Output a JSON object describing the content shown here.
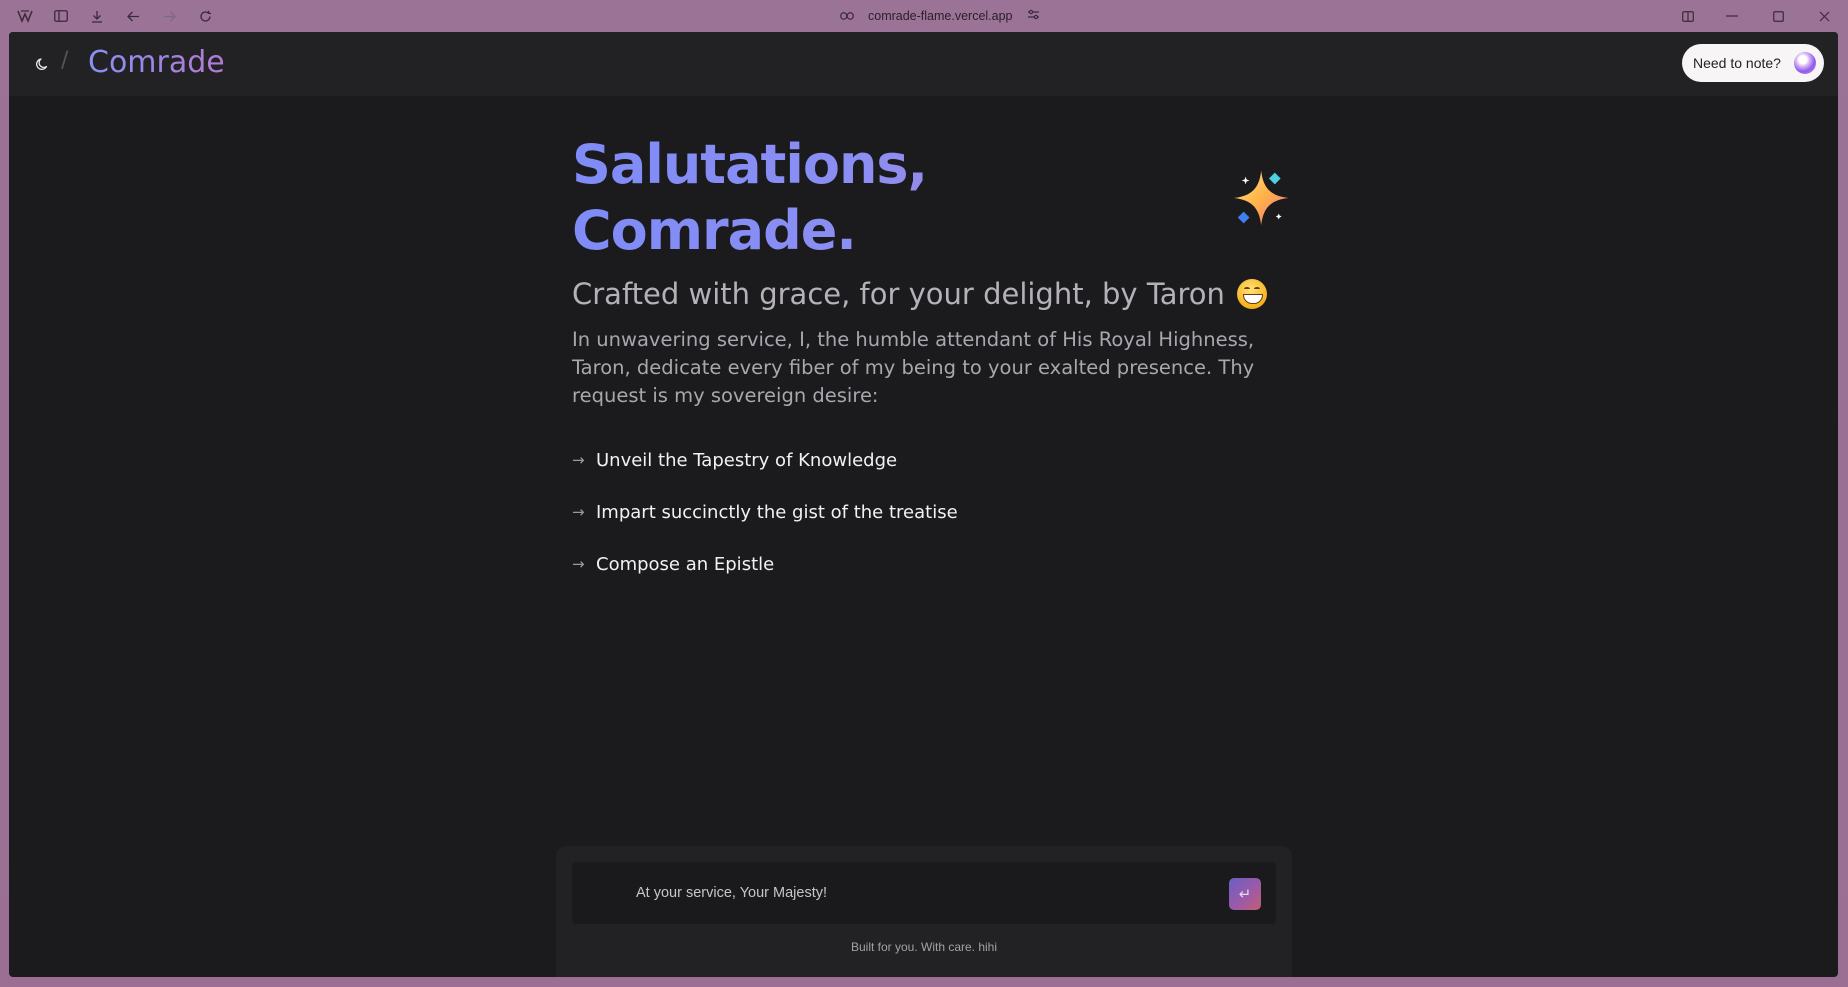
{
  "browser": {
    "url": "comrade-flame.vercel.app"
  },
  "app": {
    "brand": "Comrade",
    "note_button": "Need to note?"
  },
  "hero": {
    "title": "Salutations, Comrade.",
    "subtitle": "Crafted with grace, for your delight, by Taron",
    "intro": "In unwavering service, I, the humble attendant of His Royal Highness, Taron, dedicate every fiber of my being to your exalted presence. Thy request is my sovereign desire:"
  },
  "suggestions": [
    {
      "label": "Unveil the Tapestry of Knowledge"
    },
    {
      "label": "Impart succinctly the gist of the treatise"
    },
    {
      "label": "Compose an Epistle"
    }
  ],
  "composer": {
    "placeholder": "At your service, Your Majesty!",
    "footer": "Built for you. With care. hihi"
  },
  "icons": {
    "theme": "moon-icon",
    "send": "enter-icon",
    "arrow": "arrow-right-icon"
  },
  "colors": {
    "accent_start": "#7f8cf7",
    "accent_end": "#b68bd2",
    "background": "#1b1a1d"
  }
}
